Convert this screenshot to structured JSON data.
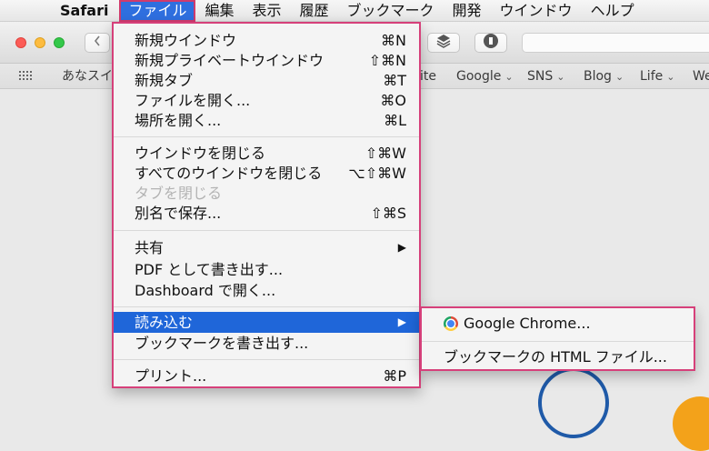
{
  "menubar": {
    "apple": "",
    "app": "Safari",
    "items": [
      "ファイル",
      "編集",
      "表示",
      "履歴",
      "ブックマーク",
      "開発",
      "ウインドウ",
      "ヘルプ"
    ]
  },
  "bookmarks_bar": {
    "items": [
      {
        "label": "あなスイ"
      },
      {
        "label": "ite"
      },
      {
        "label": "Google",
        "chevron": "⌄"
      },
      {
        "label": "SNS",
        "chevron": "⌄"
      },
      {
        "label": "Blog",
        "chevron": "⌄"
      },
      {
        "label": "Life",
        "chevron": "⌄"
      },
      {
        "label": "We"
      }
    ]
  },
  "file_menu": {
    "items": [
      {
        "label": "新規ウインドウ",
        "shortcut": "⌘N"
      },
      {
        "label": "新規プライベートウインドウ",
        "shortcut": "⇧⌘N"
      },
      {
        "label": "新規タブ",
        "shortcut": "⌘T"
      },
      {
        "label": "ファイルを開く...",
        "shortcut": "⌘O"
      },
      {
        "label": "場所を開く...",
        "shortcut": "⌘L"
      },
      {
        "label": "ウインドウを閉じる",
        "shortcut": "⇧⌘W"
      },
      {
        "label": "すべてのウインドウを閉じる",
        "shortcut": "⌥⇧⌘W"
      },
      {
        "label": "タブを閉じる",
        "shortcut": "",
        "disabled": true
      },
      {
        "label": "別名で保存...",
        "shortcut": "⇧⌘S"
      },
      {
        "label": "共有",
        "shortcut": "▶"
      },
      {
        "label": "PDF として書き出す...",
        "shortcut": ""
      },
      {
        "label": "Dashboard で開く...",
        "shortcut": ""
      },
      {
        "label": "読み込む",
        "shortcut": "▶",
        "highlighted": true
      },
      {
        "label": "ブックマークを書き出す...",
        "shortcut": ""
      },
      {
        "label": "プリント...",
        "shortcut": "⌘P"
      }
    ]
  },
  "import_submenu": {
    "items": [
      {
        "label": "Google Chrome...",
        "icon": "chrome-icon"
      },
      {
        "label": "ブックマークの HTML ファイル..."
      }
    ]
  }
}
